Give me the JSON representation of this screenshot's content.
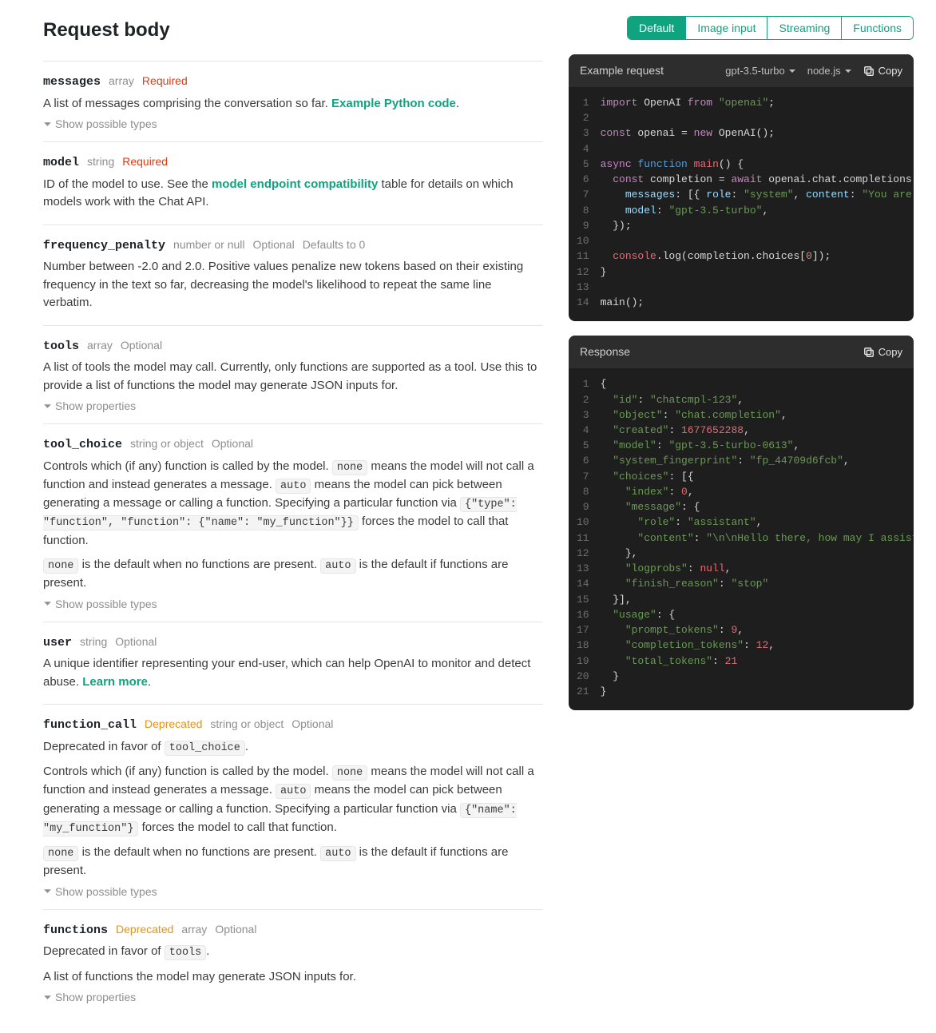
{
  "header": {
    "title": "Request body"
  },
  "tabs": [
    "Default",
    "Image input",
    "Streaming",
    "Functions"
  ],
  "active_tab": 0,
  "toggles": {
    "show_possible_types": "Show possible types",
    "show_properties": "Show properties"
  },
  "links": {
    "example_python_code": "Example Python code",
    "model_endpoint_compat": "model endpoint compatibility",
    "learn_more": "Learn more"
  },
  "tags": {
    "required": "Required",
    "optional": "Optional",
    "deprecated": "Deprecated"
  },
  "params": {
    "messages": {
      "name": "messages",
      "type": "array",
      "desc_pre": "A list of messages comprising the conversation so far. ",
      "desc_post": "."
    },
    "model": {
      "name": "model",
      "type": "string",
      "d1": "ID of the model to use. See the ",
      "d2": " table for details on which models work with the Chat API."
    },
    "frequency_penalty": {
      "name": "frequency_penalty",
      "type": "number or null",
      "default": "Defaults to 0",
      "desc": "Number between -2.0 and 2.0. Positive values penalize new tokens based on their existing frequency in the text so far, decreasing the model's likelihood to repeat the same line verbatim."
    },
    "tools": {
      "name": "tools",
      "type": "array",
      "desc": "A list of tools the model may call. Currently, only functions are supported as a tool. Use this to provide a list of functions the model may generate JSON inputs for."
    },
    "tool_choice": {
      "name": "tool_choice",
      "type": "string or object",
      "s1": "Controls which (if any) function is called by the model. ",
      "s2": " means the model will not call a function and instead generates a message. ",
      "s3": " means the model can pick between generating a message or calling a function. Specifying a particular function via ",
      "s4": " forces the model to call that function.",
      "s5": " is the default when no functions are present. ",
      "s6": " is the default if functions are present.",
      "code_none": "none",
      "code_auto": "auto",
      "code_spec": "{\"type\": \"function\", \"function\": {\"name\": \"my_function\"}}"
    },
    "user": {
      "name": "user",
      "type": "string",
      "d1": "A unique identifier representing your end-user, which can help OpenAI to monitor and detect abuse. ",
      "d2": "."
    },
    "function_call": {
      "name": "function_call",
      "type": "string or object",
      "dep_text_pre": "Deprecated in favor of ",
      "dep_code": "tool_choice",
      "dep_text_post": ".",
      "code_spec": "{\"name\": \"my_function\"}"
    },
    "functions": {
      "name": "functions",
      "type": "array",
      "dep_text_pre": "Deprecated in favor of ",
      "dep_code": "tools",
      "dep_text_post": ".",
      "desc": "A list of functions the model may generate JSON inputs for."
    }
  },
  "example_panel": {
    "title": "Example request",
    "model_sel": "gpt-3.5-turbo",
    "lang_sel": "node.js",
    "copy": "Copy",
    "line_count": 14
  },
  "response_panel": {
    "title": "Response",
    "copy": "Copy",
    "line_count": 21
  },
  "example_code_data": {
    "import_stmt": "import OpenAI from \"openai\";",
    "init": "const openai = new OpenAI();",
    "async_main": "async function main() {",
    "await_line": "  const completion = await openai.chat.completions.c",
    "messages_line": "    messages: [{ role: \"system\", content: \"You are a",
    "model_line": "    model: \"gpt-3.5-turbo\",",
    "close_obj": "  });",
    "console_log": "  console.log(completion.choices[0]);",
    "close_fn": "}",
    "call": "main();"
  },
  "response_data": {
    "id": "chatcmpl-123",
    "object": "chat.completion",
    "created": 1677652288,
    "model": "gpt-3.5-turbo-0613",
    "system_fingerprint": "fp_44709d6fcb",
    "choices": [
      {
        "index": 0,
        "message": {
          "role": "assistant",
          "content": "\\n\\nHello there, how may I assist"
        },
        "logprobs": null,
        "finish_reason": "stop"
      }
    ],
    "usage": {
      "prompt_tokens": 9,
      "completion_tokens": 12,
      "total_tokens": 21
    }
  }
}
